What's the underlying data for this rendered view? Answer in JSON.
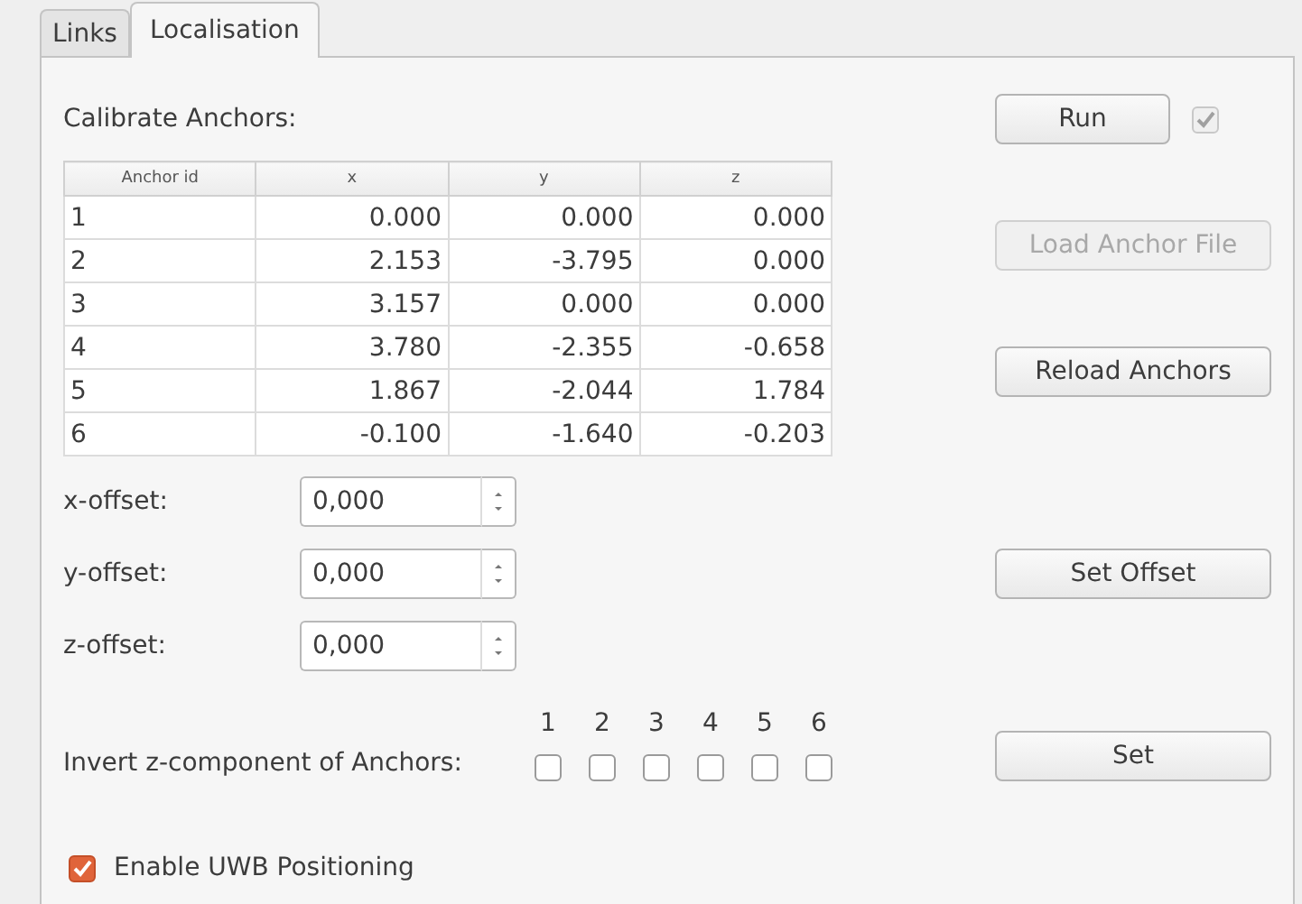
{
  "tabs": [
    {
      "label": "Links",
      "selected": false
    },
    {
      "label": "Localisation",
      "selected": true
    }
  ],
  "calibrate_label": "Calibrate Anchors:",
  "run_button": {
    "label": "Run"
  },
  "run_checkbox": {
    "checked": true,
    "disabled": true
  },
  "load_button": {
    "label": "Load Anchor File",
    "disabled": true
  },
  "reload_button": {
    "label": "Reload Anchors",
    "disabled": false
  },
  "table": {
    "columns": [
      "Anchor id",
      "x",
      "y",
      "z"
    ],
    "rows": [
      [
        "1",
        "0.000",
        "0.000",
        "0.000"
      ],
      [
        "2",
        "2.153",
        "-3.795",
        "0.000"
      ],
      [
        "3",
        "3.157",
        "0.000",
        "0.000"
      ],
      [
        "4",
        "3.780",
        "-2.355",
        "-0.658"
      ],
      [
        "5",
        "1.867",
        "-2.044",
        "1.784"
      ],
      [
        "6",
        "-0.100",
        "-1.640",
        "-0.203"
      ]
    ]
  },
  "offsets": [
    {
      "label": "x-offset:",
      "value": "0,000"
    },
    {
      "label": "y-offset:",
      "value": "0,000"
    },
    {
      "label": "z-offset:",
      "value": "0,000"
    }
  ],
  "set_offset_button": {
    "label": "Set Offset"
  },
  "invert": {
    "label": "Invert z-component of Anchors:",
    "anchors": [
      {
        "label": "1",
        "checked": false
      },
      {
        "label": "2",
        "checked": false
      },
      {
        "label": "3",
        "checked": false
      },
      {
        "label": "4",
        "checked": false
      },
      {
        "label": "5",
        "checked": false
      },
      {
        "label": "6",
        "checked": false
      }
    ]
  },
  "set_button": {
    "label": "Set"
  },
  "enable_uwb": {
    "label": "Enable UWB Positioning",
    "checked": true
  }
}
